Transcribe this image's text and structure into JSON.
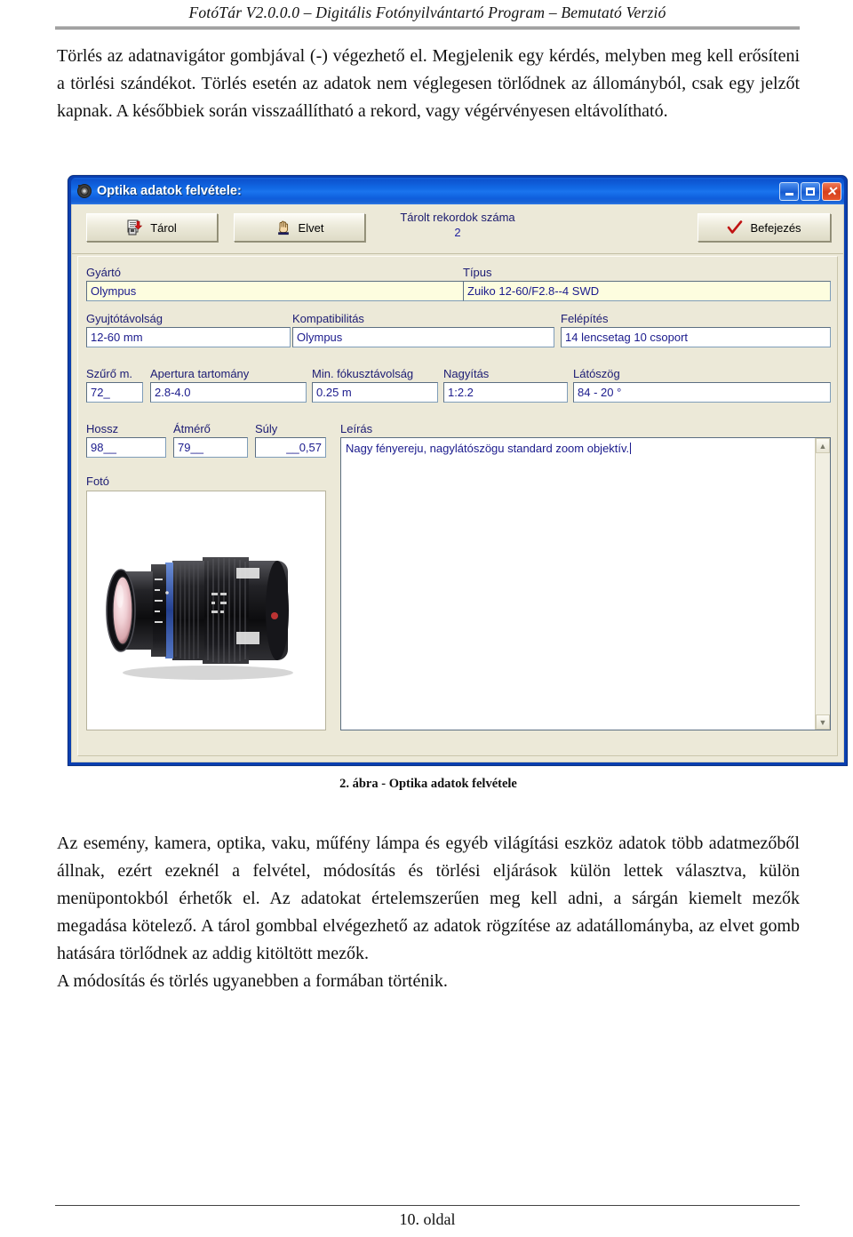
{
  "page": {
    "header": "FotóTár V2.0.0.0 – Digitális Fotónyilvántartó Program – Bemutató Verzió",
    "footer": "10. oldal"
  },
  "paragraphs": {
    "top": "Törlés az adatnavigátor gombjával (-) végezhető el. Megjelenik egy kérdés, melyben meg kell erősíteni a törlési szándékot. Törlés esetén az adatok nem véglegesen törlődnek az állományból, csak egy jelzőt kapnak. A későbbiek során visszaállítható a rekord, vagy végérvényesen eltávolítható.",
    "bottom_justified": "Az esemény, kamera, optika, vaku, műfény lámpa és egyéb világítási eszköz adatok több adatmezőből állnak, ezért ezeknél a felvétel, módosítás és törlési eljárások külön lettek választva, külön menüpontokból érhetők el. Az adatokat értelemszerűen meg kell adni, a sárgán kiemelt mezők megadása kötelező. A tárol gombbal elvégezhető az adatok rögzítése az adatállományba, az elvet gomb hatására törlődnek az addig kitöltött mezők.",
    "bottom_last_line": "A módosítás és törlés ugyanebben a formában történik."
  },
  "figure_caption": "2. ábra - Optika adatok felvétele",
  "dialog": {
    "title": "Optika adatok felvétele:",
    "title_icon": "app-camera-icon",
    "window_buttons": {
      "minimize": "minimize-icon",
      "maximize": "maximize-icon",
      "close": "close-icon"
    },
    "toolbar": {
      "save_label": "Tárol",
      "cancel_label": "Elvet",
      "finish_label": "Befejezés",
      "record_count_label": "Tárolt rekordok száma",
      "record_count_value": "2"
    },
    "fields": [
      {
        "name": "gyarto",
        "label": "Gyártó",
        "value": "Olympus",
        "required": true
      },
      {
        "name": "tipus",
        "label": "Típus",
        "value": "Zuiko 12-60/F2.8--4 SWD",
        "required": true
      },
      {
        "name": "gyujtotav",
        "label": "Gyujtótávolság",
        "value": "12-60 mm",
        "required": false
      },
      {
        "name": "kompat",
        "label": "Kompatibilitás",
        "value": "Olympus",
        "required": false
      },
      {
        "name": "felepites",
        "label": "Felépítés",
        "value": "14 lencsetag 10 csoport",
        "required": false
      },
      {
        "name": "szuro",
        "label": "Szűrő m.",
        "value": "72_",
        "required": false
      },
      {
        "name": "apertura",
        "label": "Apertura tartomány",
        "value": "2.8-4.0",
        "required": false
      },
      {
        "name": "minfokusz",
        "label": "Min. fókusztávolság",
        "value": "0.25 m",
        "required": false
      },
      {
        "name": "nagyitas",
        "label": "Nagyítás",
        "value": "1:2.2",
        "required": false
      },
      {
        "name": "latoszog",
        "label": "Látószög",
        "value": "84 - 20 °",
        "required": false
      },
      {
        "name": "hossz",
        "label": "Hossz",
        "value": "98__",
        "required": false
      },
      {
        "name": "atmero",
        "label": "Átmérő",
        "value": "79__",
        "required": false
      },
      {
        "name": "suly",
        "label": "Súly",
        "value": "__0,57",
        "required": false
      }
    ],
    "description": {
      "label": "Leírás",
      "value": "Nagy fényereju, nagylátószögu standard zoom objektív."
    },
    "photo": {
      "label": "Fotó",
      "image_alt": "olympus-zoom-lens-photo"
    },
    "scrollbar": {
      "up": "▲",
      "down": "▼"
    }
  },
  "colors": {
    "titlebar_blue": "#1a74ee",
    "window_frame": "#0a3fb0",
    "client_bg": "#ece9d8",
    "required_field_bg": "#fdfddf",
    "field_text": "#1a1a8c",
    "label_text": "#1c1c74",
    "close_red": "#d6401d"
  }
}
